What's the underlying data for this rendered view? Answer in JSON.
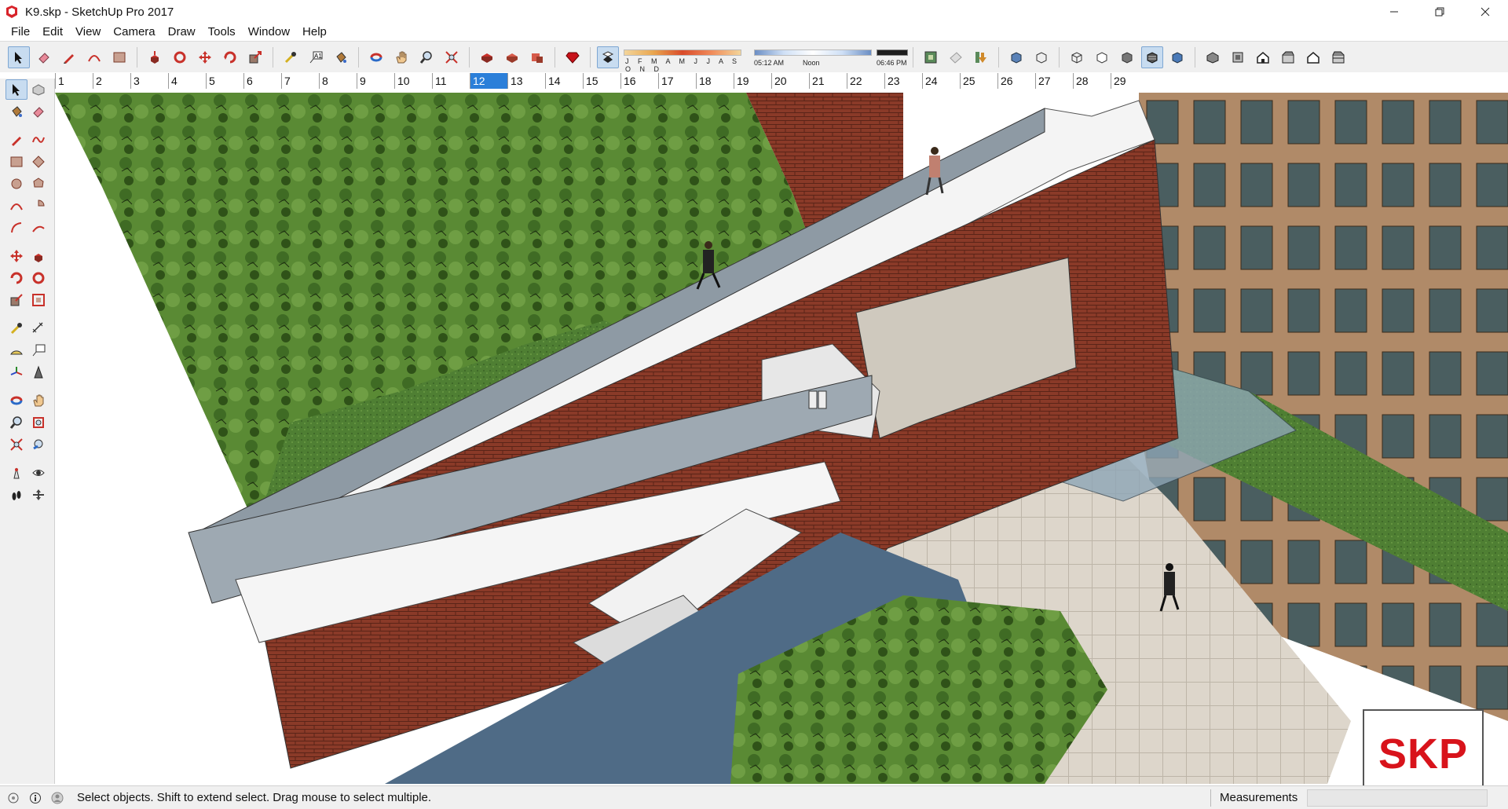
{
  "window": {
    "title": "K9.skp - SketchUp Pro 2017",
    "minimize_icon": "minimize-icon",
    "maximize_icon": "restore-icon",
    "close_icon": "close-icon"
  },
  "menu": [
    "File",
    "Edit",
    "View",
    "Camera",
    "Draw",
    "Tools",
    "Window",
    "Help"
  ],
  "toolbar": {
    "icons": [
      "select-icon",
      "eraser-icon",
      "pencil-line-icon",
      "arc-icon",
      "rectangle-icon",
      "push-pull-icon",
      "follow-me-icon",
      "move-icon",
      "rotate-icon",
      "scale-icon",
      "tape-measure-icon",
      "text-icon",
      "paint-bucket-icon",
      "orbit-icon",
      "pan-icon",
      "zoom-icon",
      "zoom-extents-icon",
      "warehouse-icon",
      "share-model-icon",
      "extension-icon",
      "ruby-icon",
      "shadows-icon"
    ],
    "shadow_months_labels": "J F M A M J J A S O N D",
    "shadow_time_start": "05:12 AM",
    "shadow_time_mid": "Noon",
    "shadow_time_end": "06:46 PM",
    "view_icons": [
      "geo-location-icon",
      "add-location-icon",
      "download-icon",
      "xray-icon",
      "back-edges-icon",
      "wireframe-icon",
      "hidden-line-icon",
      "shaded-icon",
      "shaded-textures-icon",
      "monochrome-icon",
      "iso-view-icon",
      "top-view-icon",
      "front-view-icon",
      "right-view-icon",
      "back-view-icon",
      "left-view-icon"
    ]
  },
  "scenes": {
    "tabs": [
      "1",
      "2",
      "3",
      "4",
      "5",
      "6",
      "7",
      "8",
      "9",
      "10",
      "11",
      "12",
      "13",
      "14",
      "15",
      "16",
      "17",
      "18",
      "19",
      "20",
      "21",
      "22",
      "23",
      "24",
      "25",
      "26",
      "27",
      "28",
      "29"
    ],
    "active": "12"
  },
  "left_tools": [
    [
      "select-icon",
      "component-icon"
    ],
    [
      "paint-bucket-icon",
      "eraser-icon"
    ],
    [
      "pencil-line-icon",
      "freehand-icon"
    ],
    [
      "rectangle-icon",
      "rotated-rectangle-icon"
    ],
    [
      "circle-icon",
      "polygon-icon"
    ],
    [
      "arc-icon",
      "pie-icon"
    ],
    [
      "two-point-arc-icon",
      "three-point-arc-icon"
    ],
    [
      "move-icon",
      "push-pull-icon"
    ],
    [
      "rotate-icon",
      "follow-me-icon"
    ],
    [
      "scale-icon",
      "offset-icon"
    ],
    [
      "tape-measure-icon",
      "dimension-icon"
    ],
    [
      "protractor-icon",
      "text-label-icon"
    ],
    [
      "axes-icon",
      "3d-text-icon"
    ],
    [
      "orbit-icon",
      "pan-icon"
    ],
    [
      "zoom-icon",
      "zoom-window-icon"
    ],
    [
      "zoom-extents-icon",
      "previous-view-icon"
    ],
    [
      "position-camera-icon",
      "look-around-icon"
    ],
    [
      "walk-icon",
      "section-plane-icon"
    ]
  ],
  "viewport": {
    "badge": "SKP"
  },
  "statusbar": {
    "text": "Select objects. Shift to extend select. Drag mouse to select multiple.",
    "measurements_label": "Measurements",
    "measurements_value": "",
    "icons": [
      "geo-icon",
      "info-icon",
      "user-icon"
    ]
  },
  "colors": {
    "brick": "#8a3a28",
    "grass": "#4f7f33",
    "tree": "#5a8a34",
    "glass": "#7f98a8",
    "water": "#4f6b86",
    "paving": "#d9d2c6",
    "facade": "#b08a68",
    "accent": "#2b7fd9",
    "badge_red": "#d8131b"
  }
}
